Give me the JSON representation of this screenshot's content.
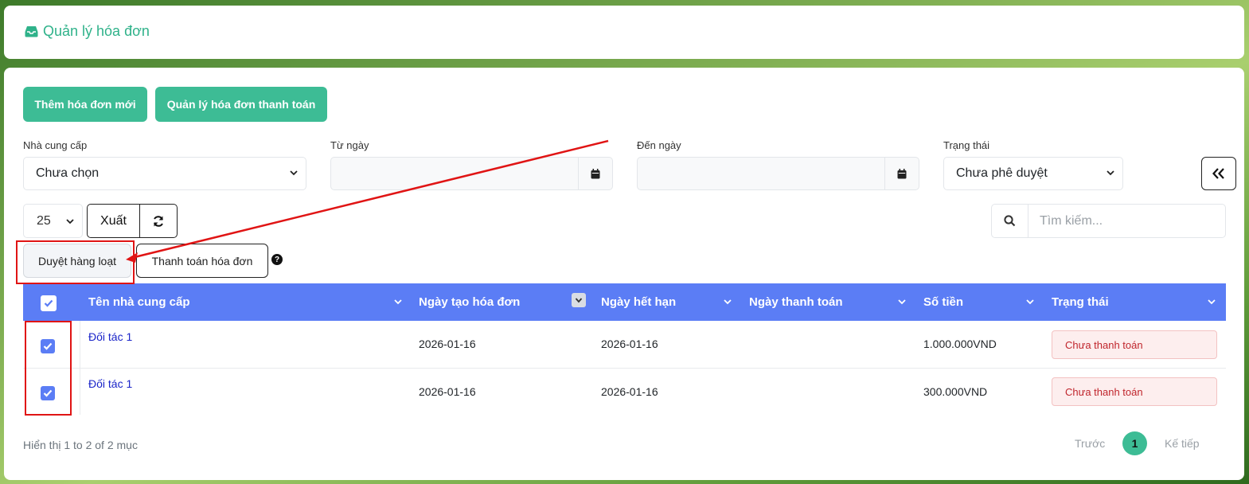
{
  "header": {
    "title": "Quản lý hóa đơn",
    "icon": "inbox-icon"
  },
  "toolbar": {
    "add_label": "Thêm hóa đơn mới",
    "manage_payment_label": "Quản lý hóa đơn thanh toán"
  },
  "filters": {
    "supplier": {
      "label": "Nhà cung cấp",
      "value": "Chưa chọn"
    },
    "from_date": {
      "label": "Từ ngày",
      "value": ""
    },
    "to_date": {
      "label": "Đến ngày",
      "value": ""
    },
    "status": {
      "label": "Trạng thái",
      "value": "Chưa phê duyệt"
    }
  },
  "controls": {
    "page_size": "25",
    "export_label": "Xuất",
    "search_placeholder": "Tìm kiếm..."
  },
  "actions": {
    "bulk_approve": "Duyệt hàng loạt",
    "pay_invoice": "Thanh toán hóa đơn",
    "help_icon": "?"
  },
  "table": {
    "columns": [
      "Tên nhà cung cấp",
      "Ngày tạo hóa đơn",
      "Ngày hết hạn",
      "Ngày thanh toán",
      "Số tiền",
      "Trạng thái"
    ],
    "rows": [
      {
        "supplier": "Đối tác 1",
        "created": "2026-01-16",
        "due": "2026-01-16",
        "paid": "",
        "amount": "1.000.000VND",
        "status": "Chưa thanh toán",
        "checked": true
      },
      {
        "supplier": "Đối tác 1",
        "created": "2026-01-16",
        "due": "2026-01-16",
        "paid": "",
        "amount": "300.000VND",
        "status": "Chưa thanh toán",
        "checked": true
      }
    ]
  },
  "footer": {
    "info": "Hiển thị 1 to 2 of 2 mục",
    "prev": "Trước",
    "page": "1",
    "next": "Kế tiếp"
  },
  "colors": {
    "accent": "#3dbc95",
    "table_header": "#5b7df5",
    "annotation": "#e01414",
    "badge_text": "#c0262d"
  }
}
